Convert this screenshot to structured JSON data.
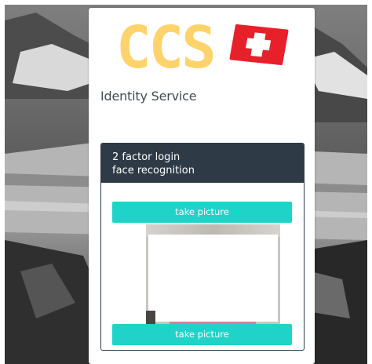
{
  "brand": {
    "logo_text": "CCS",
    "flag_icon": "swiss-flag-icon",
    "logo_color": "#ffd36b",
    "flag_color": "#e8202a"
  },
  "service": {
    "title": "Identity Service"
  },
  "panel": {
    "header_line1": "2 factor login",
    "header_line2": "face recognition",
    "header_color": "#2e3a46"
  },
  "actions": {
    "take_picture_top": "take picture",
    "take_picture_bottom": "take picture",
    "button_color": "#20d3c8"
  },
  "camera": {
    "preview_icon": "camera-preview"
  }
}
